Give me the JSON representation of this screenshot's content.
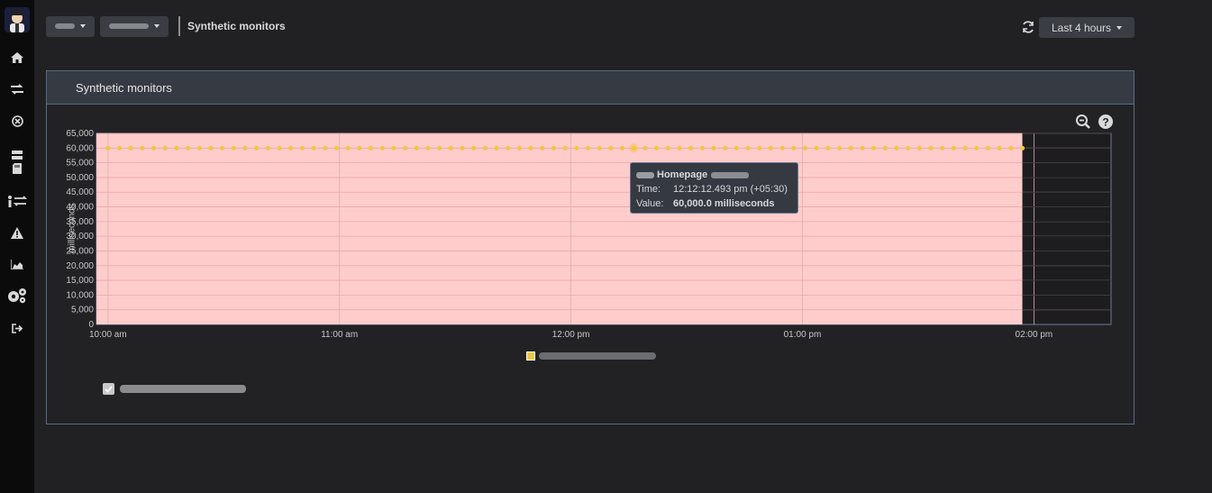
{
  "breadcrumb": {
    "title": "Synthetic monitors"
  },
  "toolbar": {
    "time_range_label": "Last 4 hours"
  },
  "panel": {
    "title": "Synthetic monitors"
  },
  "sidebar": {
    "items": [
      {
        "icon": "home-icon"
      },
      {
        "icon": "transfer-icon"
      },
      {
        "icon": "close-circle-icon"
      },
      {
        "icon": "database-icon"
      },
      {
        "icon": "user-transfer-icon"
      },
      {
        "icon": "warning-icon"
      },
      {
        "icon": "area-chart-icon"
      },
      {
        "icon": "gears-icon"
      },
      {
        "icon": "sign-out-icon"
      }
    ]
  },
  "tooltip": {
    "title_label": "Homepage",
    "time_label": "Time:",
    "time_value": "12:12:12.493 pm (+05:30)",
    "value_label": "Value:",
    "value_value": "60,000.0 milliseconds"
  },
  "colors": {
    "background": "#212124",
    "panel_header": "#363a42",
    "panel_border": "#5a6a86",
    "alert_fill": "#ffcccc",
    "series": "#f2c645"
  },
  "chart_data": {
    "type": "scatter",
    "ylabel": "milliseconds",
    "ylim": [
      0,
      65000
    ],
    "yticks": [
      "0",
      "5,000",
      "10,000",
      "15,000",
      "20,000",
      "25,000",
      "30,000",
      "35,000",
      "40,000",
      "45,000",
      "50,000",
      "55,000",
      "60,000",
      "65,000"
    ],
    "xticks": [
      "10:00 am",
      "11:00 am",
      "12:00 pm",
      "01:00 pm",
      "02:00 pm"
    ],
    "x_start": "09:57 am",
    "x_end": "02:20 pm",
    "alert_region": {
      "from": "09:57 am",
      "to": "01:57 pm"
    },
    "series": [
      {
        "values_constant": 60000,
        "start": "10:00 am",
        "end": "01:57 pm",
        "point_count": 81
      }
    ],
    "grid": true,
    "legend": "bottom-center"
  }
}
